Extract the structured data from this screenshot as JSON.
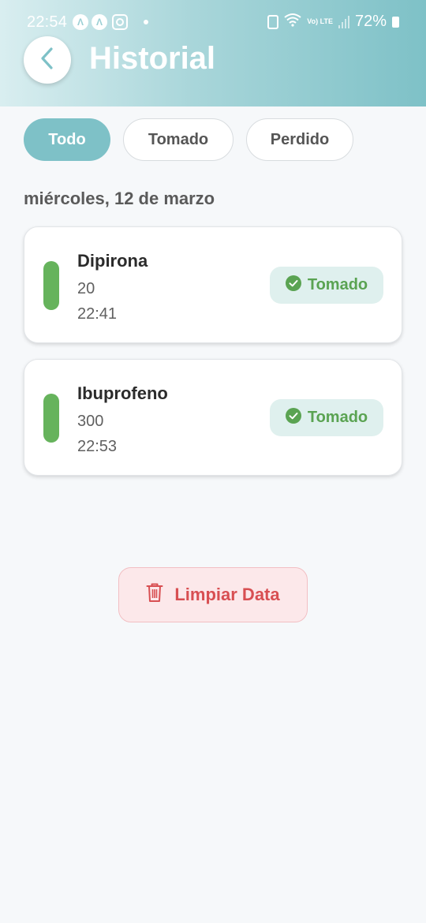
{
  "status_bar": {
    "time": "22:54",
    "battery": "72%",
    "network_label": "Vo) LTE"
  },
  "header": {
    "title": "Historial"
  },
  "filters": [
    "Todo",
    "Tomado",
    "Perdido"
  ],
  "active_filter": "Todo",
  "date_heading": "miércoles, 12 de marzo",
  "entries": [
    {
      "name": "Dipirona",
      "dose": "20",
      "time": "22:41",
      "status": "Tomado"
    },
    {
      "name": "Ibuprofeno",
      "dose": "300",
      "time": "22:53",
      "status": "Tomado"
    }
  ],
  "clear_button": {
    "label": "Limpiar Data"
  },
  "colors": {
    "accent": "#7ec1c7",
    "taken_green": "#66b35c",
    "danger": "#d84f52"
  },
  "icons": {
    "back": "chevron-left-icon",
    "status": "check-circle-icon",
    "clear": "trash-icon"
  }
}
